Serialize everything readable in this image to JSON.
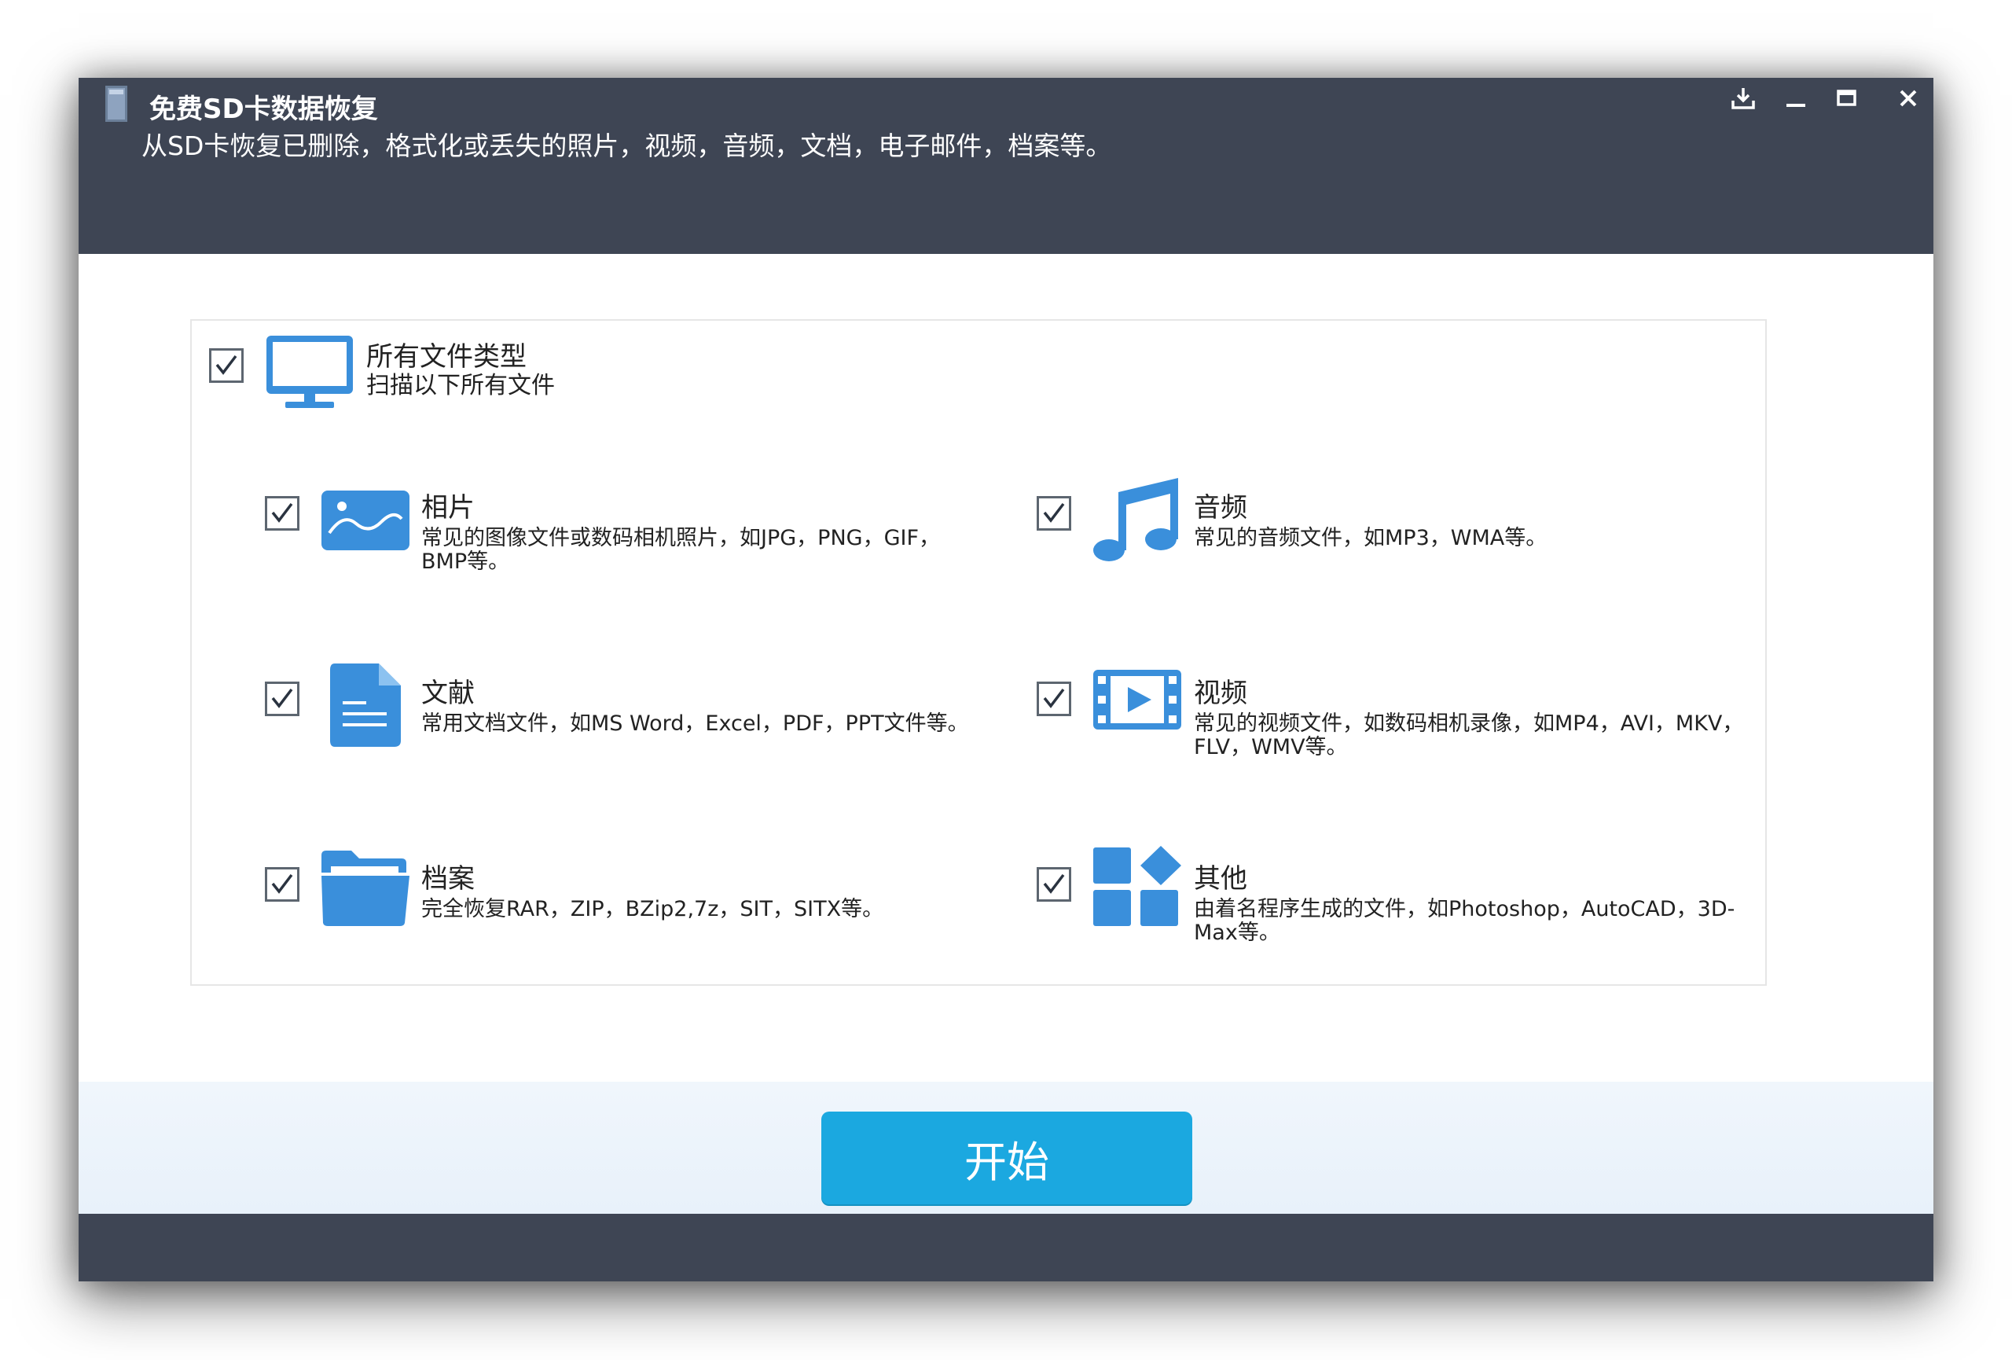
{
  "window": {
    "title": "免费SD卡数据恢复",
    "subtitle": "从SD卡恢复已删除，格式化或丢失的照片，视频，音频，文档，电子邮件，档案等。",
    "controls": [
      "download-icon",
      "minimize-icon",
      "maximize-icon",
      "close-icon"
    ]
  },
  "all_types": {
    "title": "所有文件类型",
    "description": "扫描以下所有文件",
    "checked": true,
    "icon": "monitor-icon"
  },
  "file_types": [
    {
      "title": "相片",
      "description": "常见的图像文件或数码相机照片，如JPG，PNG，GIF，BMP等。",
      "checked": true,
      "icon": "image-icon"
    },
    {
      "title": "音频",
      "description": "常见的音频文件，如MP3，WMA等。",
      "checked": true,
      "icon": "music-note-icon"
    },
    {
      "title": "文献",
      "description": "常用文档文件，如MS Word，Excel，PDF，PPT文件等。",
      "checked": true,
      "icon": "document-icon"
    },
    {
      "title": "视频",
      "description": "常见的视频文件，如数码相机录像，如MP4，AVI，MKV，FLV，WMV等。",
      "checked": true,
      "icon": "video-icon"
    },
    {
      "title": "档案",
      "description": "完全恢复RAR，ZIP，BZip2,7z，SIT，SITX等。",
      "checked": true,
      "icon": "folder-icon"
    },
    {
      "title": "其他",
      "description": "由着名程序生成的文件，如Photoshop，AutoCAD，3D-Max等。",
      "checked": true,
      "icon": "other-apps-icon"
    }
  ],
  "start_button": {
    "label": "开始"
  },
  "colors": {
    "header": "#3e4554",
    "icon_blue": "#3a8fdb",
    "button": "#1ba8e0"
  }
}
